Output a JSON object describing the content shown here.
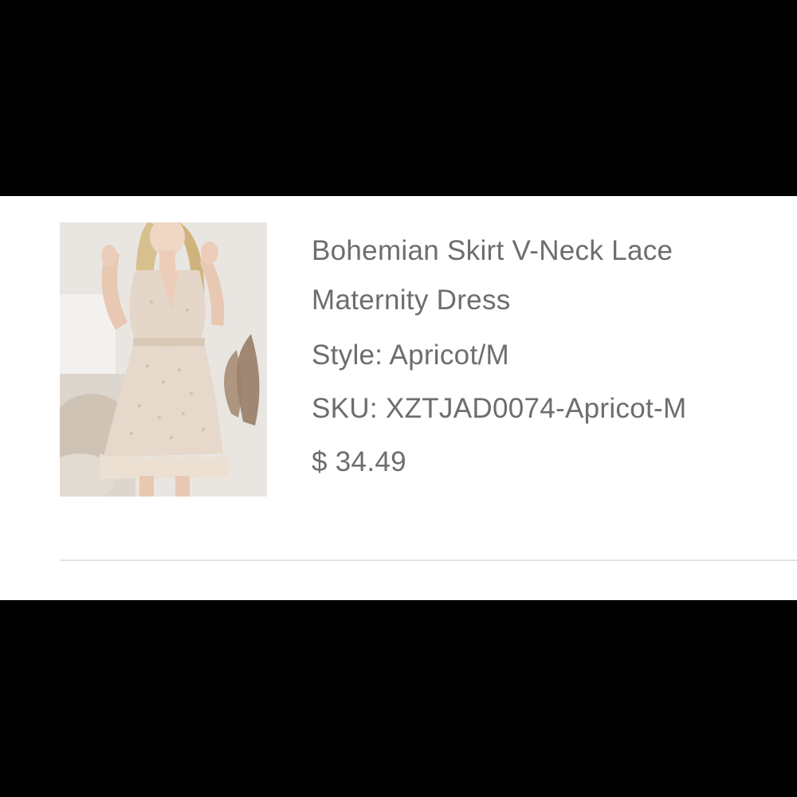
{
  "product": {
    "title": "Bohemian Skirt V-Neck Lace Maternity Dress",
    "style_label": "Style:",
    "style_value": "Apricot/M",
    "sku_label": "SKU:",
    "sku_value": "XZTJAD0074-Apricot-M",
    "currency": "$",
    "price": "34.49"
  },
  "colors": {
    "text": "#6d6d6d",
    "divider": "#e3e3e3",
    "card_background": "#ffffff",
    "letterbox": "#000000",
    "dress": "#e4d6c8"
  }
}
